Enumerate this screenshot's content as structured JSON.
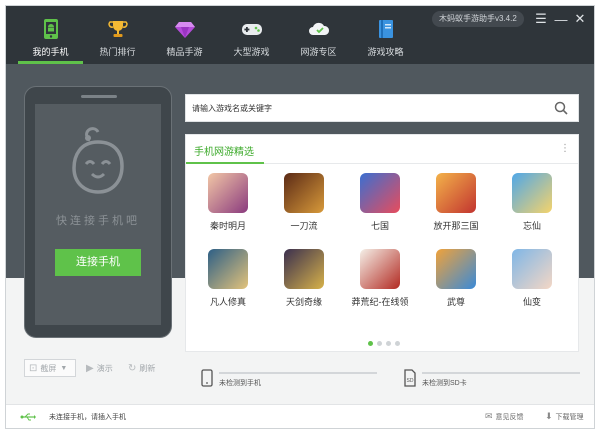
{
  "app": {
    "version": "木蚂蚁手游助手v3.4.2"
  },
  "header": {
    "tabs": [
      {
        "label": "我的手机",
        "icon": "android-phone-icon",
        "active": true
      },
      {
        "label": "热门排行",
        "icon": "trophy-icon",
        "active": false
      },
      {
        "label": "精品手游",
        "icon": "diamond-icon",
        "active": false
      },
      {
        "label": "大型游戏",
        "icon": "gamepad-icon",
        "active": false
      },
      {
        "label": "网游专区",
        "icon": "cloud-icon",
        "active": false
      },
      {
        "label": "游戏攻略",
        "icon": "book-icon",
        "active": false
      }
    ]
  },
  "colors": {
    "accent": "#5fc24a",
    "header_bg": "#2f353a",
    "band_bg": "#50585e",
    "phone_body": "#3f464b",
    "phone_screen": "#555c61"
  },
  "phone": {
    "hint": "快连接手机吧",
    "connect_label": "连接手机"
  },
  "search": {
    "placeholder": "请输入游戏名或关键字"
  },
  "games_panel": {
    "title": "手机网游精选",
    "games": [
      {
        "name": "秦时明月",
        "colors": [
          "#f2c7a6",
          "#8a3a7e"
        ]
      },
      {
        "name": "一刀流",
        "colors": [
          "#5b2a16",
          "#d89a3a"
        ]
      },
      {
        "name": "七国",
        "colors": [
          "#3a6fd1",
          "#e84c5c"
        ]
      },
      {
        "name": "放开那三国",
        "colors": [
          "#f3b24a",
          "#c2342f"
        ]
      },
      {
        "name": "忘仙",
        "colors": [
          "#4fa7e8",
          "#f5d36b"
        ]
      },
      {
        "name": "凡人修真",
        "colors": [
          "#2d5f86",
          "#e3c37b"
        ]
      },
      {
        "name": "天剑奇缘",
        "colors": [
          "#3a2f4e",
          "#d7b24a"
        ]
      },
      {
        "name": "莽荒纪-在线领",
        "colors": [
          "#f5f0e8",
          "#b22a22"
        ]
      },
      {
        "name": "武尊",
        "colors": [
          "#f0a23a",
          "#3a8ad8"
        ]
      },
      {
        "name": "仙变",
        "colors": [
          "#7fb6e6",
          "#f4d7c5"
        ]
      }
    ],
    "page_count": 4,
    "active_page": 1
  },
  "tools": {
    "screenshot_label": "截屏",
    "demo_label": "演示",
    "refresh_label": "刷新"
  },
  "storage": {
    "phone_status": "未检测到手机",
    "sd_status": "未检测到SD卡",
    "sd_badge": "SD"
  },
  "status_bar": {
    "message": "未连接手机，请插入手机",
    "feedback_label": "意见反馈",
    "download_label": "下载管理"
  }
}
